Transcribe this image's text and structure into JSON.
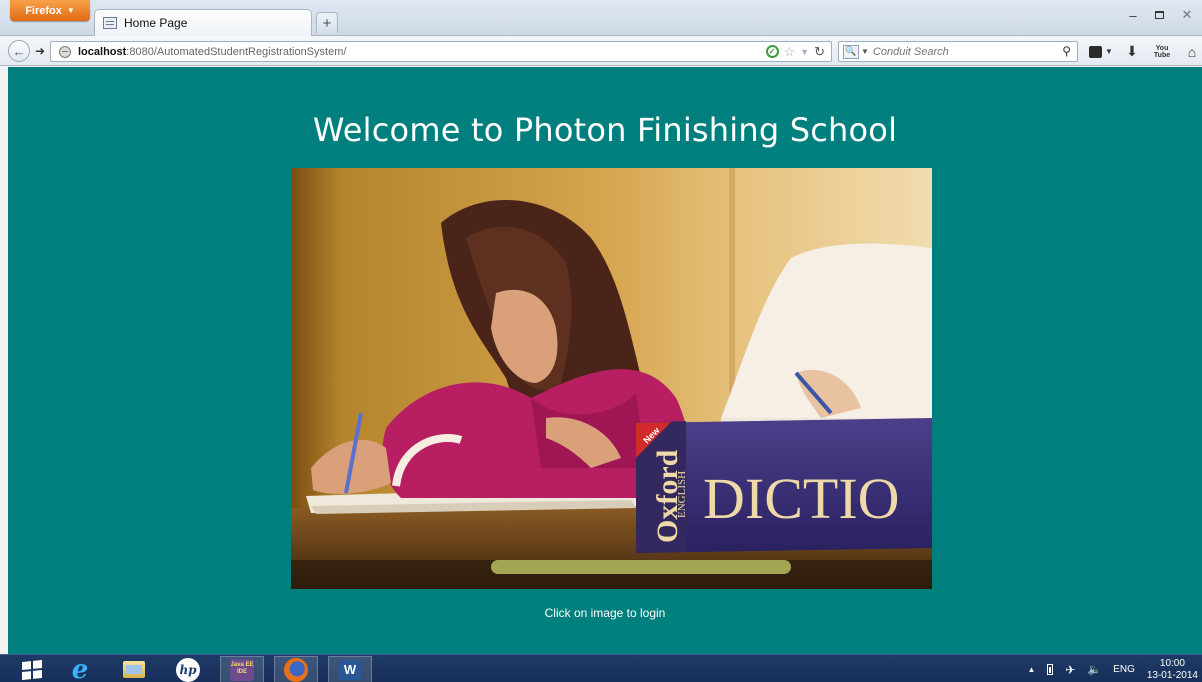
{
  "browser": {
    "app_button_label": "Firefox",
    "tab_title": "Home Page",
    "new_tab_label": "+",
    "url_host": "localhost",
    "url_rest": ":8080/AutomatedStudentRegistrationSystem/",
    "search_placeholder": "Conduit Search"
  },
  "page": {
    "heading": "Welcome to Photon Finishing School",
    "image_alt": "Students studying with an Oxford English Dictionary",
    "image_book_text": "DICTIO",
    "image_book_spine_brand": "Oxford",
    "image_book_spine_sub": "ENGLISH",
    "image_book_corner": "New",
    "hint": "Click on image to login"
  },
  "taskbar": {
    "javaee_label": "Java EE IDE",
    "word_label": "W",
    "hp_label": "hp",
    "tray_language": "ENG",
    "clock_time": "10:00",
    "clock_date": "13-01-2014"
  },
  "icons": {
    "youtube_top": "You",
    "youtube_bottom": "Tube"
  }
}
